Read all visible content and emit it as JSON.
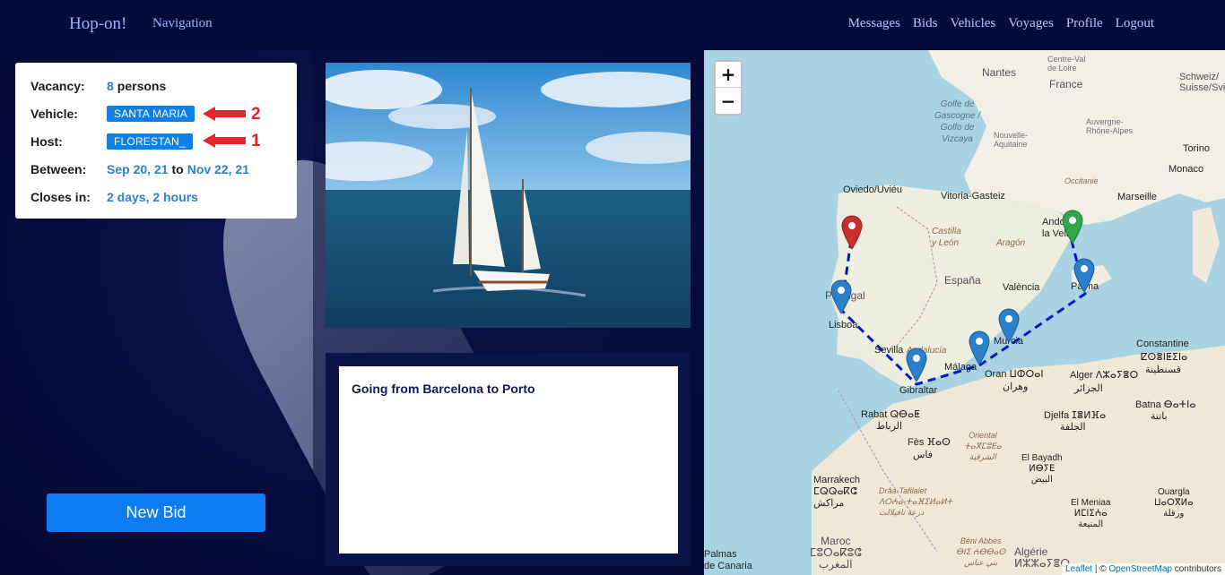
{
  "navbar": {
    "brand": "Hop-on!",
    "navigation_label": "Navigation",
    "links": [
      "Messages",
      "Bids",
      "Vehicles",
      "Voyages",
      "Profile",
      "Logout"
    ]
  },
  "voyage": {
    "vacancy_label": "Vacancy:",
    "vacancy_count": "8",
    "vacancy_unit": "persons",
    "vehicle_label": "Vehicle:",
    "vehicle_name": "SANTA MARIA",
    "host_label": "Host:",
    "host_name": "FLORESTAN_",
    "between_label": "Between:",
    "start_date": "Sep 20, 21",
    "to_word": "to",
    "end_date": "Nov 22, 21",
    "closes_label": "Closes in:",
    "closes_value": "2 days, 2 hours",
    "description": "Going from Barcelona to Porto"
  },
  "annotations": {
    "arrow_vehicle": "2",
    "arrow_host": "1"
  },
  "actions": {
    "new_bid": "New Bid"
  },
  "map": {
    "zoom_in": "+",
    "zoom_out": "−",
    "attribution_leaflet": "Leaflet",
    "attribution_sep": " | © ",
    "attribution_osm": "OpenStreetMap",
    "attribution_tail": " contributors",
    "labels": {
      "nantes": "Nantes",
      "france": "France",
      "centre": "Centre-Val\nde Loire",
      "schweiz": "Schweiz/\nSuisse/Svizz",
      "suisse": "Suisse",
      "auvergne": "Auvergne-\nRhône-Alpes",
      "nouvelle": "Nouvelle-\nAquitaine",
      "golfe": "Golfe de\nGascogne /\nGolfo de\nVizcaya",
      "monaco": "Monaco",
      "torino": "Torino",
      "occitanie": "Occitanie",
      "marseille": "Marseille",
      "oviedo": "Oviedo/Uviéu",
      "vitoria": "Vitoria-Gasteiz",
      "castilla": "Castilla\ny León",
      "aragon": "Aragón",
      "andorra": "Andorra\nla Vella",
      "espana": "España",
      "valencia": "València",
      "palma": "Palma",
      "portugal": "Portugal",
      "lisboa": "Lisboa",
      "sevilla": "Sevilla",
      "andalucia": "Andalucía",
      "malaga": "Málaga",
      "murcia": "Murcia",
      "gibraltar": "Gibraltar",
      "oran": "Oran ⵡⵀⵔⴰⵏ",
      "oran_ar": "وهران",
      "alger": "Alger ⴷⵣⴰⵢⴻⵔ",
      "alger_ar": "الجزائر",
      "constantine": "Constantine",
      "constantine_t": "ⵇⵙⴻⵏⵟⵉⵏⴰ",
      "constantine_ar": "قسنطينة",
      "rabat": "Rabat ⵕⴱⴰⵟ",
      "rabat_ar": "الرباط",
      "djelfa": "Djelfa ⵊⴻⵍⴼⴰ",
      "djelfa_ar": "الجلفة",
      "batna": "Batna ⴱⴰⵜⵏⴰ",
      "batna_ar": "باتنة",
      "fes": "Fès ⴼⴰⵙ",
      "fes_ar": "فاس",
      "oriental": "Oriental\nⵜⴰⴳⵎⵓⴹⴰ\nالشرقية",
      "el_bayadh": "El Bayadh\nⵍⴱⵢⴹ\nالبيض",
      "marrakech": "Marrakech\nⵎⵕⵕⴰⴽⵛ\nمراكش",
      "draa": "Drâa-Tafilalet\nⴷⵔⵄⴰ-ⵜⴰⴼⵉⵍⴰⵍⵜ\nدرعة تافيلالت",
      "el_menia": "El Meniaa\nⵍⵎⵏⵉⵄⴰ\nالمنيعة",
      "ouargla": "Ouargla\nⵡⴰⵔⴳⵍⴰ\nورقلة",
      "maroc": "Maroc\nⵎⵓⵔⴰⴽⵓⵛ\nالمغرب",
      "beni_abbes": "Béni Abbès\nⴱⵏⵉ ⵄⴱⴱⴰⵙ\nبني عباس",
      "algerie": "Algérie\nⵍⵣⵣⴰⵢⴻⵔ",
      "palmas": "Palmas\nde Canaria"
    }
  },
  "colors": {
    "background": "#050b3a",
    "nav_link": "#b6c6ff",
    "badge": "#0d80e8",
    "accent_link": "#2c7fd1",
    "button": "#0d7cf3",
    "annotation_red": "#e3262b",
    "route": "#0019c9",
    "marker_start": "#2ea84a",
    "marker_end": "#c9302c",
    "marker_waypoint": "#2a81cb"
  }
}
